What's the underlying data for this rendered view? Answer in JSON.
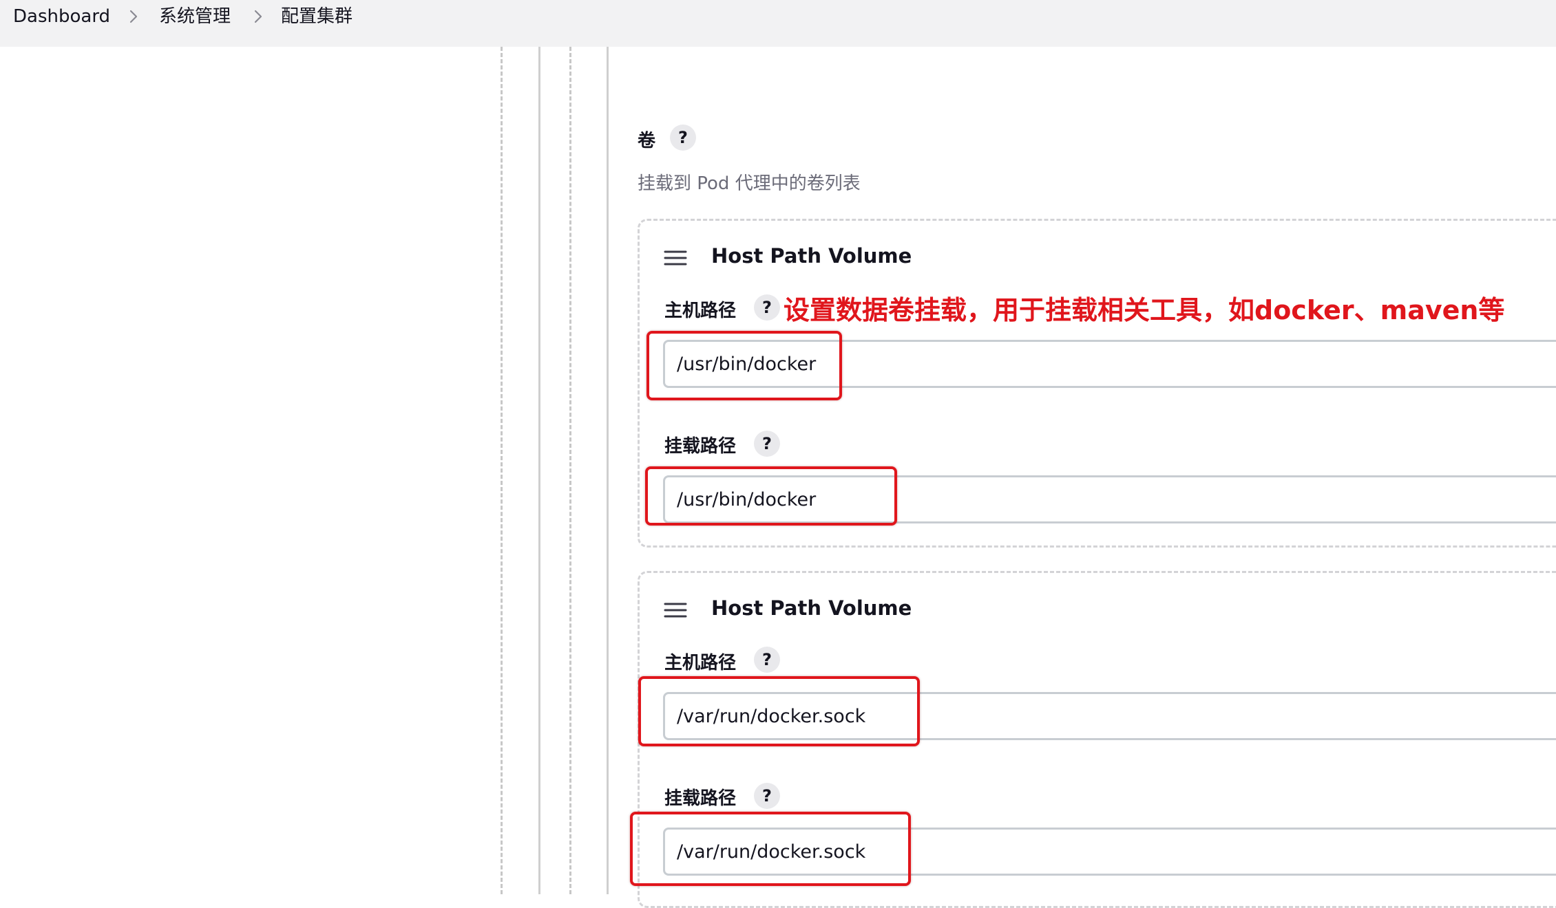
{
  "breadcrumb": {
    "items": [
      "Dashboard",
      "系统管理",
      "配置集群"
    ]
  },
  "volumes_section": {
    "label": "卷",
    "help": "?",
    "description": "挂载到 Pod 代理中的卷列表"
  },
  "volume_cards": [
    {
      "title": "Host Path Volume",
      "host_path_label": "主机路径",
      "host_path_value": "/usr/bin/docker",
      "mount_path_label": "挂载路径",
      "mount_path_value": "/usr/bin/docker"
    },
    {
      "title": "Host Path Volume",
      "host_path_label": "主机路径",
      "host_path_value": "/var/run/docker.sock",
      "mount_path_label": "挂载路径",
      "mount_path_value": "/var/run/docker.sock"
    }
  ],
  "help_mark": "?",
  "annotation": {
    "text": "设置数据卷挂载，用于挂载相关工具，如docker、maven等",
    "color": "#e0161c"
  },
  "icons": {
    "breadcrumb_separator": "chevron-right-icon",
    "drag_handle": "drag-handle-icon"
  }
}
